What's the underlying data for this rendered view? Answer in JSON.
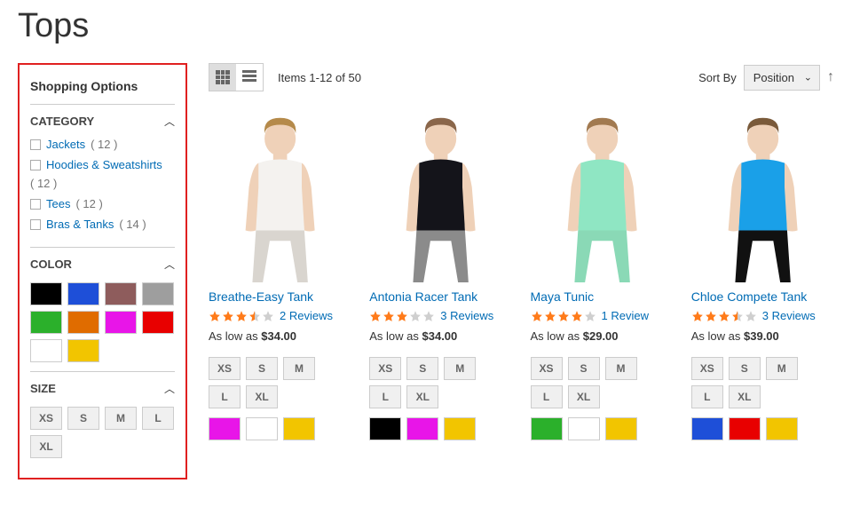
{
  "page": {
    "title": "Tops"
  },
  "sidebar": {
    "title": "Shopping Options",
    "category": {
      "label": "CATEGORY",
      "items": [
        {
          "label": "Jackets",
          "count": "( 12 )"
        },
        {
          "label": "Hoodies & Sweatshirts",
          "count": "( 12 )"
        },
        {
          "label": "Tees",
          "count": "( 12 )"
        },
        {
          "label": "Bras & Tanks",
          "count": "( 14 )"
        }
      ]
    },
    "color": {
      "label": "COLOR",
      "swatches": [
        "#000000",
        "#1e4fd8",
        "#8e5c5c",
        "#9e9e9e",
        "#2bb02b",
        "#e06c00",
        "#e815e8",
        "#e80000",
        "#ffffff",
        "#f2c500"
      ]
    },
    "size": {
      "label": "SIZE",
      "options": [
        "XS",
        "S",
        "M",
        "L",
        "XL"
      ]
    }
  },
  "toolbar": {
    "count_text": "Items 1-12 of 50",
    "sort_label": "Sort By",
    "sort_value": "Position"
  },
  "products": [
    {
      "name": "Breathe-Easy Tank",
      "rating": 3.5,
      "reviews": "2 Reviews",
      "price_label": "As low as",
      "price": "$34.00",
      "sizes": [
        "XS",
        "S",
        "M",
        "L",
        "XL"
      ],
      "colors": [
        "#e815e8",
        "#ffffff",
        "#f2c500"
      ],
      "img": {
        "skin": "#efd1b8",
        "hair": "#b58a4a",
        "shirt": "#f4f2ef",
        "bottom": "#d9d5cf"
      }
    },
    {
      "name": "Antonia Racer Tank",
      "rating": 3.0,
      "reviews": "3 Reviews",
      "price_label": "As low as",
      "price": "$34.00",
      "sizes": [
        "XS",
        "S",
        "M",
        "L",
        "XL"
      ],
      "colors": [
        "#000000",
        "#e815e8",
        "#f2c500"
      ],
      "img": {
        "skin": "#efd1b8",
        "hair": "#8a664a",
        "shirt": "#14141a",
        "bottom": "#8b8b8b"
      }
    },
    {
      "name": "Maya Tunic",
      "rating": 4.0,
      "reviews": "1 Review",
      "price_label": "As low as",
      "price": "$29.00",
      "sizes": [
        "XS",
        "S",
        "M",
        "L",
        "XL"
      ],
      "colors": [
        "#2bb02b",
        "#ffffff",
        "#f2c500"
      ],
      "img": {
        "skin": "#efd1b8",
        "hair": "#a27a50",
        "shirt": "#8fe6c3",
        "bottom": "#8ad9b6"
      }
    },
    {
      "name": "Chloe Compete Tank",
      "rating": 3.5,
      "reviews": "3 Reviews",
      "price_label": "As low as",
      "price": "$39.00",
      "sizes": [
        "XS",
        "S",
        "M",
        "L",
        "XL"
      ],
      "colors": [
        "#1e4fd8",
        "#e80000",
        "#f2c500"
      ],
      "img": {
        "skin": "#efd1b8",
        "hair": "#7a5a3a",
        "shirt": "#1aa0e8",
        "bottom": "#111111"
      }
    }
  ]
}
